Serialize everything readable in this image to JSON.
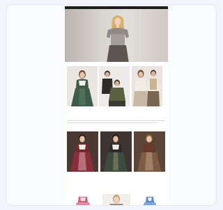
{
  "colors": {
    "page_bg": "#f3f5fa",
    "card_bg": "#fafbfe",
    "topbar": "#1d1d1d",
    "dirndl_green": "#3d5a4a",
    "dirndl_red": "#8a2f3a",
    "dirndl_pink": "#e08aa4",
    "dirndl_blue": "#7aa7e0"
  },
  "topbar": {
    "text": ""
  },
  "hero": {
    "logo": "",
    "nav": "",
    "caption": ""
  },
  "categories": [
    {
      "name": "women-dirndl"
    },
    {
      "name": "men-tracht"
    },
    {
      "name": "couple-tracht"
    }
  ],
  "section": {
    "title": "",
    "subtitle": ""
  },
  "products": [
    {
      "label": ""
    },
    {
      "label": ""
    },
    {
      "label": ""
    }
  ],
  "new_arrivals": {
    "title": "",
    "tabs": [
      "",
      ""
    ]
  }
}
